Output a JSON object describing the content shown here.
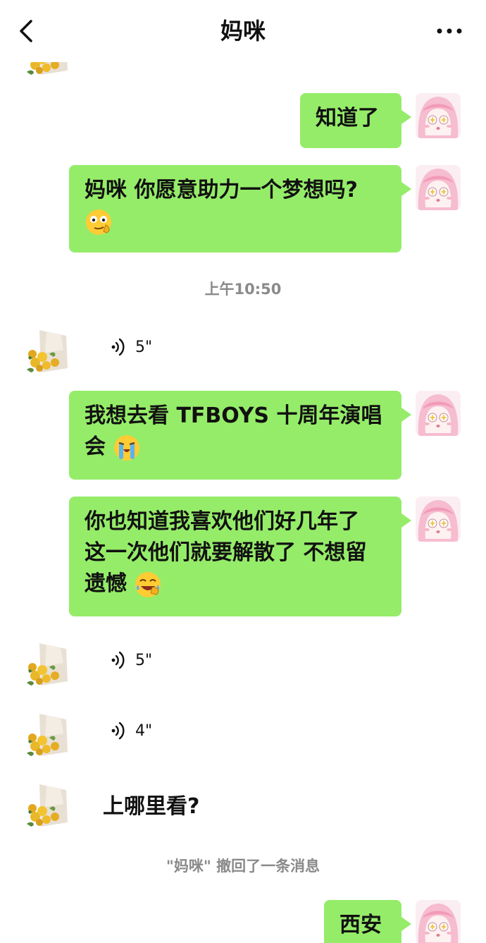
{
  "header": {
    "title": "妈咪"
  },
  "messages": [
    {
      "text": "知道了"
    },
    {
      "text": "妈咪  你愿意助力一个梦想吗?"
    },
    {
      "time": "上午10:50"
    },
    {
      "voice": "5\""
    },
    {
      "line1": "我想去看 TFBOYS 十周年演唱",
      "line2": "会"
    },
    {
      "line1": "你也知道我喜欢他们好几年了",
      "line2": "这一次他们就要解散了  不想留",
      "line3": "遗憾"
    },
    {
      "voice": "5\""
    },
    {
      "voice": "4\""
    },
    {
      "text": "上哪里看?"
    },
    {
      "recall": "\"妈咪\"  撤回了一条消息"
    },
    {
      "text": "西安"
    }
  ],
  "colors": {
    "bubble": "#95ec69",
    "background": "#ffffff",
    "system_text": "#8a8a8a"
  },
  "icons": [
    "back-icon",
    "more-icon",
    "voice-icon",
    "smirk-emoji",
    "crying-emoji",
    "laugh-cry-emoji"
  ]
}
